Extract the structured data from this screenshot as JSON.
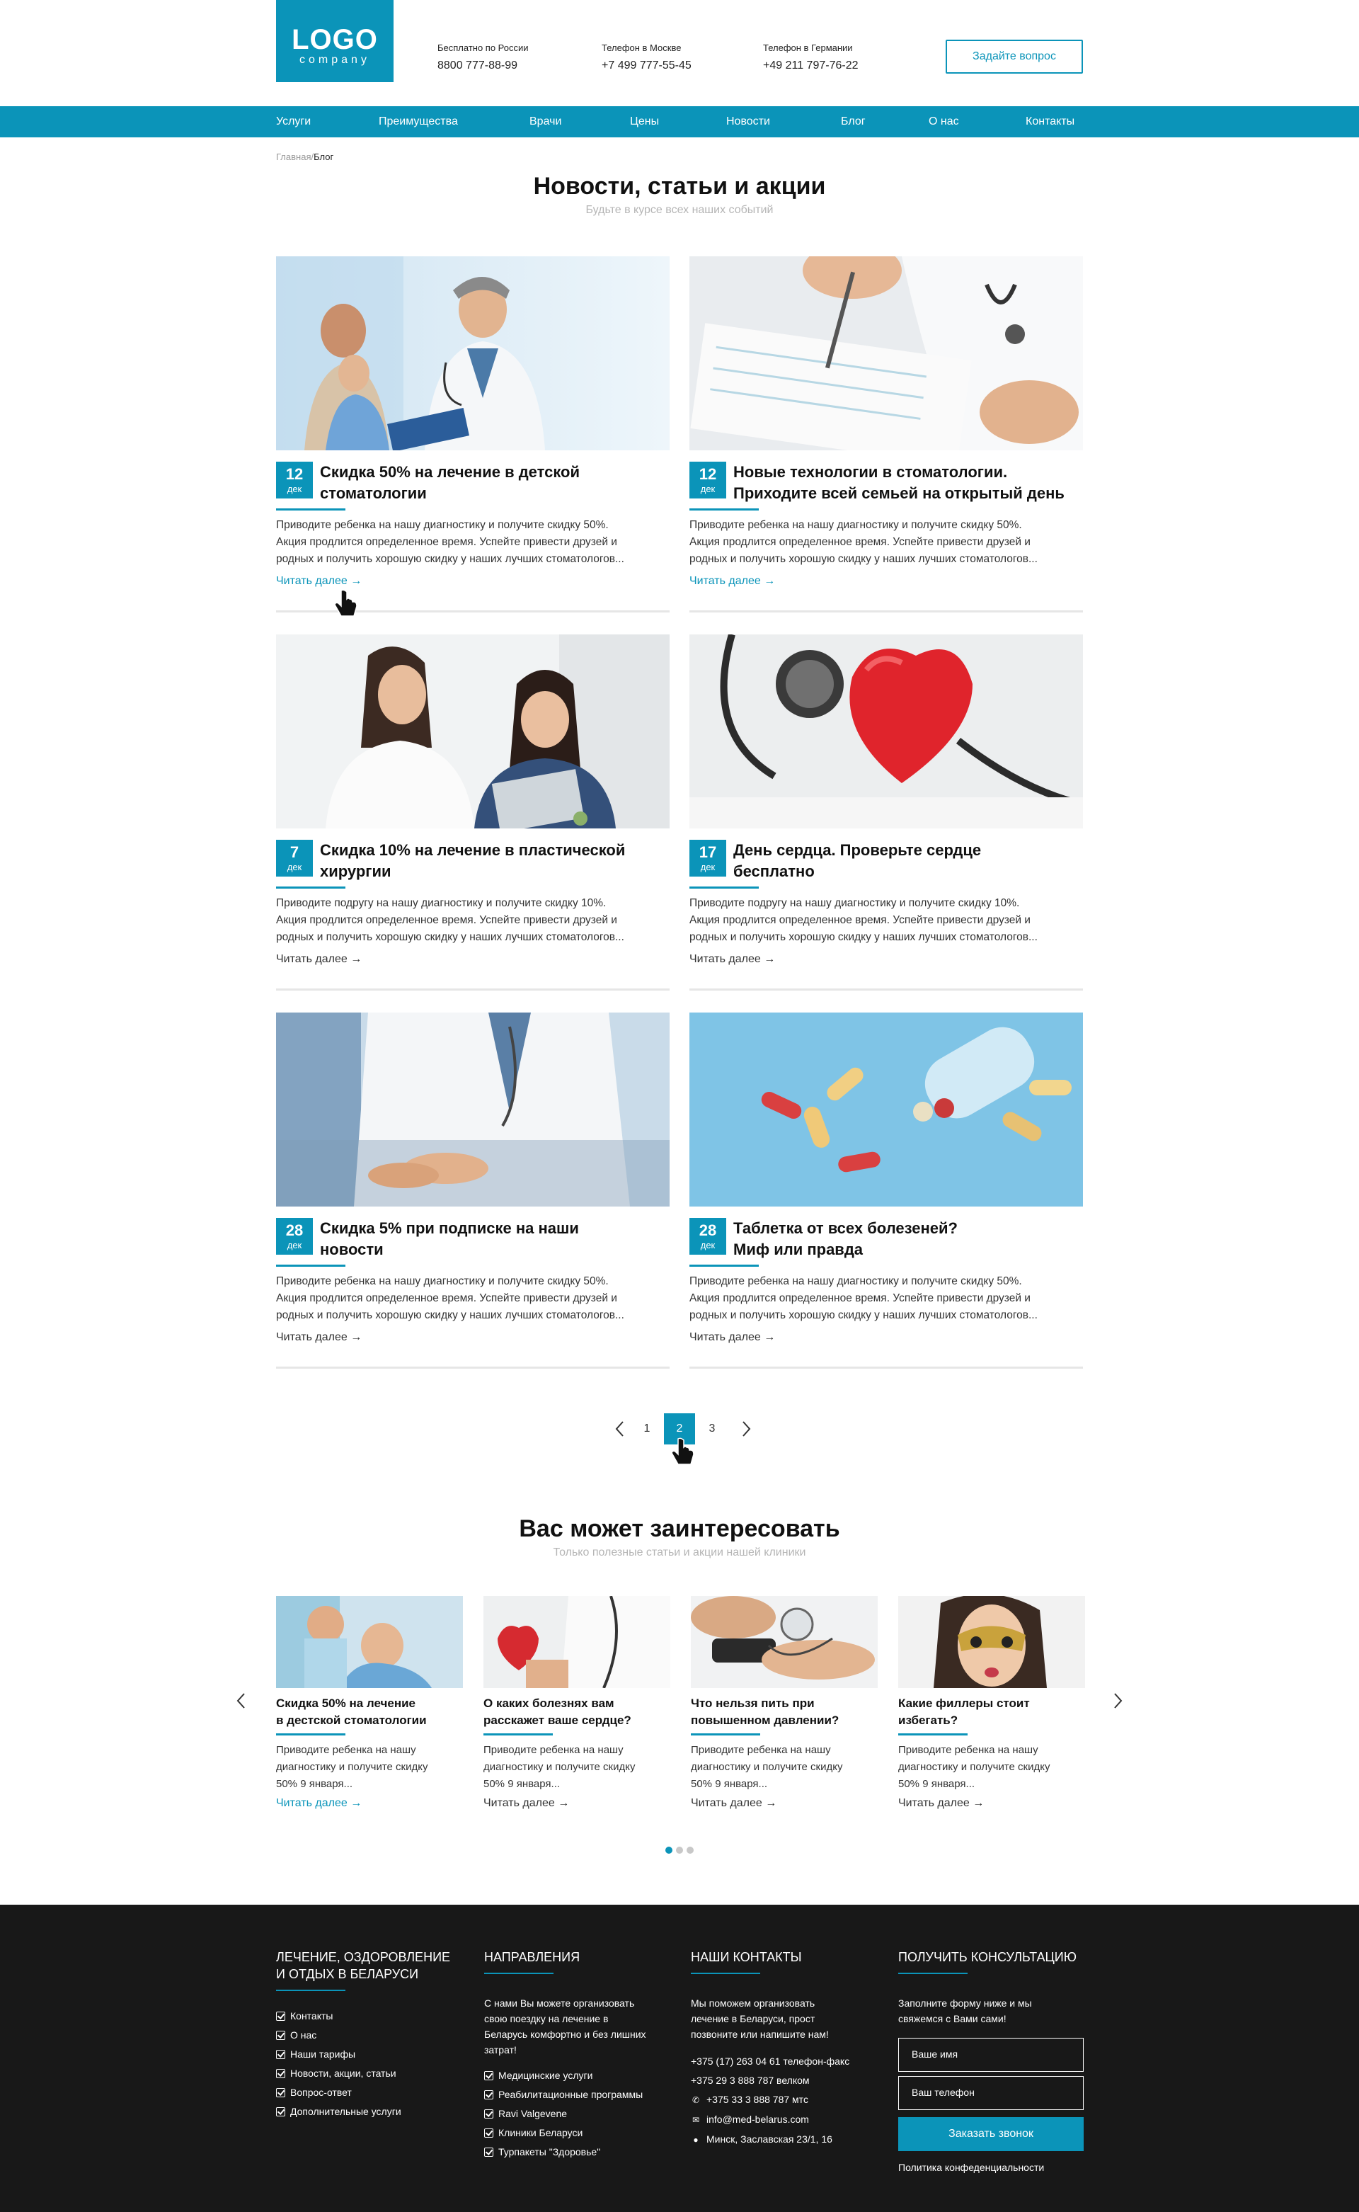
{
  "header": {
    "logo_main": "LOGO",
    "logo_sub": "company",
    "contacts": [
      {
        "label": "Бесплатно по России",
        "value": "8800 777-88-99"
      },
      {
        "label": "Телефон в Москве",
        "value": "+7 499  777-55-45"
      },
      {
        "label": "Телефон в Германии",
        "value": "+49 211 797-76-22"
      }
    ],
    "ask_button": "Задайте вопрос"
  },
  "nav": {
    "items": [
      "Услуги",
      "Преимущества",
      "Врачи",
      "Цены",
      "Новости",
      "Блог",
      "О нас",
      "Контакты"
    ]
  },
  "breadcrumb": {
    "home": "Главная",
    "separator": "/",
    "current": "Блог"
  },
  "news_section": {
    "title": "Новости, статьи и акции",
    "subtitle": "Будьте в курсе всех наших событий"
  },
  "articles": [
    {
      "day": "12",
      "month": "дек",
      "title_1": "Скидка 50% на лечение в детской",
      "title_2": "стоматологии",
      "text_1": "Приводите ребенка на нашу диагностику и получите скидку 50%.",
      "text_2": "Акция продлится определенное время. Успейте привести друзей и",
      "text_3": "родных и получить хорошую скидку у наших лучших стоматологов...",
      "more": "Читать далее →"
    },
    {
      "day": "12",
      "month": "дек",
      "title_1": "Новые технологии в стоматологии.",
      "title_2": "Приходите всей семьей на открытый день",
      "text_1": "Приводите ребенка на нашу диагностику и получите скидку 50%.",
      "text_2": "Акция продлится определенное время. Успейте привести друзей и",
      "text_3": "родных и получить хорошую скидку у наших лучших стоматологов...",
      "more": "Читать далее →"
    },
    {
      "day": "7",
      "month": "дек",
      "title_1": "Скидка 10% на лечение в пластической",
      "title_2": "хирургии",
      "text_1": "Приводите подругу на нашу диагностику и получите скидку 10%.",
      "text_2": "Акция продлится определенное время. Успейте привести друзей и",
      "text_3": "родных и получить хорошую скидку у наших лучших стоматологов...",
      "more": "Читать далее →"
    },
    {
      "day": "17",
      "month": "дек",
      "title_1": "День сердца. Проверьте сердце",
      "title_2": "бесплатно",
      "text_1": "Приводите подругу на нашу диагностику и получите скидку 10%.",
      "text_2": "Акция продлится определенное время. Успейте привести друзей и",
      "text_3": "родных и получить хорошую скидку у наших лучших стоматологов...",
      "more": "Читать далее →"
    },
    {
      "day": "28",
      "month": "дек",
      "title_1": "Скидка 5% при подписке на наши",
      "title_2": "новости",
      "text_1": "Приводите ребенка на нашу диагностику и получите скидку 50%.",
      "text_2": "Акция продлится определенное время. Успейте привести друзей и",
      "text_3": "родных и получить хорошую скидку у наших лучших стоматологов...",
      "more": "Читать далее →"
    },
    {
      "day": "28",
      "month": "дек",
      "title_1": "Таблетка от всех болезеней?",
      "title_2": "Миф или правда",
      "text_1": "Приводите ребенка на нашу диагностику и получите скидку 50%.",
      "text_2": "Акция продлится определенное время. Успейте привести друзей и",
      "text_3": "родных и получить хорошую скидку у наших лучших стоматологов...",
      "more": "Читать далее →"
    }
  ],
  "pagination": {
    "pages": [
      "1",
      "2",
      "3"
    ],
    "current": "2"
  },
  "related_section": {
    "title": "Вас может заинтересовать",
    "subtitle": "Только полезные статьи и акции нашей клиники"
  },
  "related": [
    {
      "title_1": "Скидка 50% на лечение",
      "title_2": "в дестской стоматологии",
      "text_1": "Приводите ребенка на нашу",
      "text_2": "диагностику и получите скидку",
      "text_3": "50% 9 января...",
      "more": "Читать далее →"
    },
    {
      "title_1": "О каких болезнях вам",
      "title_2": "расскажет ваше сердце?",
      "text_1": "Приводите ребенка на нашу",
      "text_2": "диагностику и получите скидку",
      "text_3": "50% 9 января...",
      "more": "Читать далее →"
    },
    {
      "title_1": "Что нельзя пить при",
      "title_2": "повышенном давлении?",
      "text_1": "Приводите ребенка на нашу",
      "text_2": "диагностику и получите скидку",
      "text_3": "50% 9 января...",
      "more": "Читать далее →"
    },
    {
      "title_1": "Какие филлеры стоит",
      "title_2": "избегать?",
      "text_1": "Приводите ребенка на нашу",
      "text_2": "диагностику и получите скидку",
      "text_3": "50% 9 января...",
      "more": "Читать далее →"
    }
  ],
  "footer": {
    "col1": {
      "head_1": "ЛЕЧЕНИЕ, ОЗДОРОВЛЕНИЕ",
      "head_2": "И ОТДЫХ В БЕЛАРУСИ",
      "items": [
        "Контакты",
        "О нас",
        "Наши тарифы",
        "Новости, акции, статьи",
        "Вопрос-ответ",
        "Дополнительные услуги"
      ]
    },
    "col2": {
      "head": "НАПРАВЛЕНИЯ",
      "text_1": "С нами Вы можете организовать",
      "text_2": "свою поездку на лечение в",
      "text_3": "Беларусь комфортно и без лишних",
      "text_4": "затрат!",
      "items": [
        "Медицинские услуги",
        "Реабилитационные программы",
        "Ravi Valgevene",
        "Клиники Беларуси",
        "Турпакеты \"Здоровье\""
      ]
    },
    "col3": {
      "head": "НАШИ КОНТАКТЫ",
      "text_1": "Мы поможем организовать",
      "text_2": "лечение в Беларуси, прост",
      "text_3": "позвоните или напишите нам!",
      "phone_1": "+375 (17) 263 04 61 телефон-факс",
      "phone_2": "+375 29 3 888 787 велком",
      "phone_3": "+375 33 3 888 787 мтс",
      "email": "info@med-belarus.com",
      "address": "Минск, Заславская 23/1, 16"
    },
    "col4": {
      "head": "ПОЛУЧИТЬ КОНСУЛЬТАЦИЮ",
      "text_1": "Заполните форму ниже и мы",
      "text_2": "свяжемся с Вами сами!",
      "name_placeholder": "Ваше имя",
      "phone_placeholder": "Ваш телефон",
      "button": "Заказать звонок",
      "policy": "Политика конфеденциальности"
    }
  },
  "colors": {
    "accent": "#0b94b9",
    "footer_bg": "#181818"
  }
}
